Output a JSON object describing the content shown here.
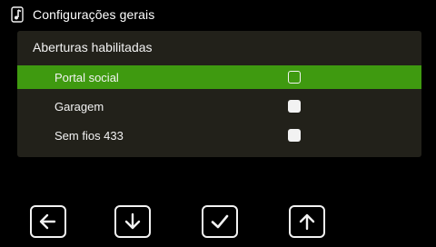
{
  "header": {
    "title": "Configurações gerais",
    "icon": "music-note-icon"
  },
  "panel": {
    "title": "Aberturas habilitadas",
    "items": [
      {
        "label": "Portal social",
        "checked": false,
        "selected": true
      },
      {
        "label": "Garagem",
        "checked": false,
        "selected": false
      },
      {
        "label": "Sem fios 433",
        "checked": false,
        "selected": false
      }
    ]
  },
  "nav": [
    {
      "icon": "arrow-left-icon"
    },
    {
      "icon": "arrow-down-icon"
    },
    {
      "icon": "check-icon"
    },
    {
      "icon": "arrow-up-icon"
    }
  ],
  "colors": {
    "background": "#000000",
    "panel": "#22211a",
    "selected": "#3f9a10",
    "foreground": "#f2f2f2"
  }
}
